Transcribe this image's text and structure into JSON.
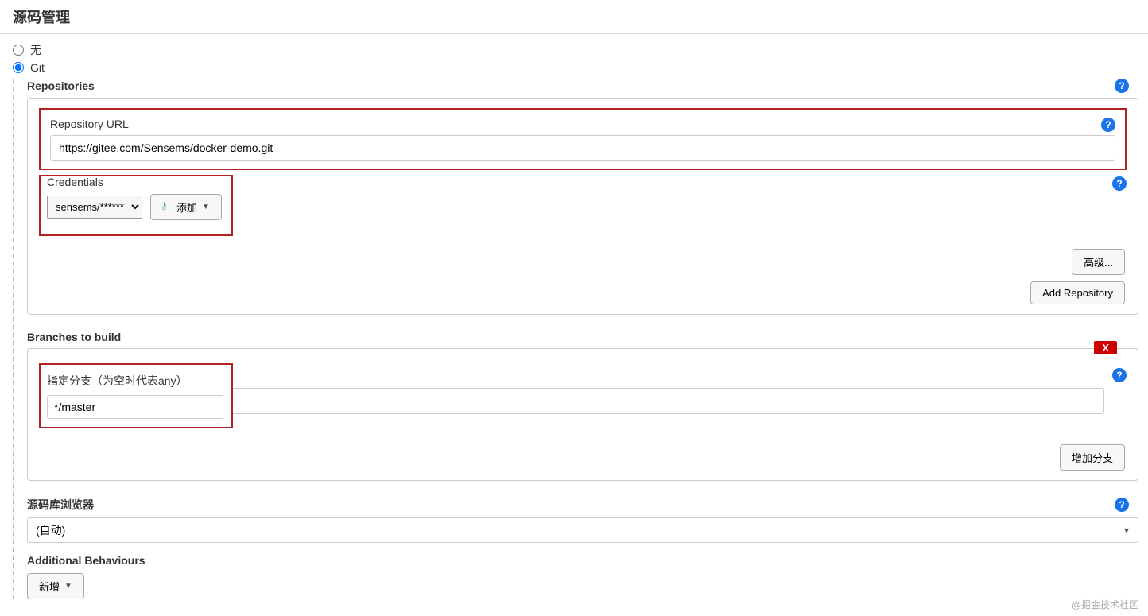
{
  "section_title": "源码管理",
  "radios": {
    "none_label": "无",
    "git_label": "Git"
  },
  "repositories": {
    "title": "Repositories",
    "url_label": "Repository URL",
    "url_value": "https://gitee.com/Sensems/docker-demo.git",
    "credentials_label": "Credentials",
    "credentials_value": "sensems/******",
    "add_btn": "添加",
    "advanced_btn": "高级...",
    "add_repo_btn": "Add Repository"
  },
  "branches": {
    "title": "Branches to build",
    "specifier_label": "指定分支（为空时代表any）",
    "specifier_value": "*/master",
    "delete_label": "X",
    "add_branch_btn": "增加分支"
  },
  "browser": {
    "title": "源码库浏览器",
    "value": "(自动)"
  },
  "behaviours": {
    "title": "Additional Behaviours",
    "add_btn": "新增"
  },
  "watermark": "@掘金技术社区"
}
